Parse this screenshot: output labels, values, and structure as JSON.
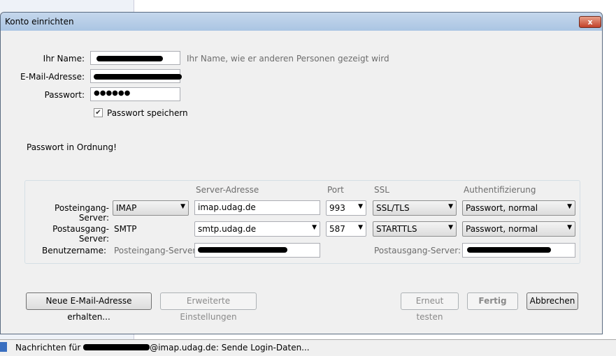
{
  "dialog": {
    "title": "Konto einrichten",
    "close": "x"
  },
  "form": {
    "name_label": "Ihr Name:",
    "name_hint": "Ihr Name, wie er anderen Personen gezeigt wird",
    "email_label": "E-Mail-Adresse:",
    "password_label": "Passwort:",
    "password_value": "●●●●●●",
    "save_password_label": "Passwort speichern",
    "save_password_checked": true,
    "password_status": "Passwort in Ordnung!"
  },
  "server": {
    "headers": {
      "address": "Server-Adresse",
      "port": "Port",
      "ssl": "SSL",
      "auth": "Authentifizierung"
    },
    "incoming": {
      "label": "Posteingang-Server:",
      "type": "IMAP",
      "address": "imap.udag.de",
      "port": "993",
      "ssl": "SSL/TLS",
      "auth": "Passwort, normal"
    },
    "outgoing": {
      "label": "Postausgang-Server:",
      "type": "SMTP",
      "address": "smtp.udag.de",
      "port": "587",
      "ssl": "STARTTLS",
      "auth": "Passwort, normal"
    },
    "username": {
      "label": "Benutzername:",
      "incoming_label": "Posteingang-Server:",
      "outgoing_label": "Postausgang-Server:"
    }
  },
  "buttons": {
    "new_email": "Neue E-Mail-Adresse erhalten...",
    "advanced": "Erweiterte Einstellungen",
    "retest": "Erneut testen",
    "done": "Fertig",
    "cancel": "Abbrechen"
  },
  "status": {
    "prefix": "Nachrichten für ",
    "suffix": "@imap.udag.de: Sende Login-Daten..."
  }
}
